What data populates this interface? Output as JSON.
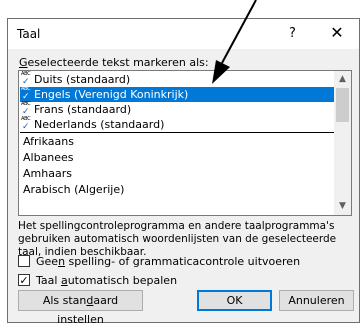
{
  "dialog": {
    "title": "Taal",
    "help": "?",
    "close": "✕"
  },
  "mark_label": {
    "pre": "",
    "access_key": "G",
    "post": "eselecteerde tekst markeren als:"
  },
  "languages_top": [
    {
      "label": "Duits (standaard)",
      "spell_icon": true,
      "selected": false
    },
    {
      "label": "Engels (Verenigd Koninkrijk)",
      "spell_icon": true,
      "selected": true
    },
    {
      "label": "Frans (standaard)",
      "spell_icon": true,
      "selected": false
    },
    {
      "label": "Nederlands (standaard)",
      "spell_icon": true,
      "selected": false
    }
  ],
  "languages_other": [
    "Afrikaans",
    "Albanees",
    "Amhaars",
    "Arabisch (Algerije)"
  ],
  "info_text": "Het spellingcontroleprogramma en andere taalprogramma's gebruiken automatisch woordenlijsten van de geselecteerde taal, indien beschikbaar.",
  "checkboxes": {
    "no_check": {
      "pre": "Gee",
      "key": "n",
      "post": " spelling- of grammaticacontrole uitvoeren",
      "checked": false
    },
    "auto_detect": {
      "pre": "Taal ",
      "key": "a",
      "post": "utomatisch bepalen",
      "checked": true
    }
  },
  "buttons": {
    "default": {
      "pre": "Als stan",
      "key": "d",
      "post": "aard instellen"
    },
    "ok": "OK",
    "cancel": "Annuleren"
  },
  "icons": {
    "spell": "spelling-check-icon",
    "check": "✓",
    "abc": "ABC"
  },
  "colors": {
    "selection": "#0078d7",
    "accent": "#0078d7"
  }
}
